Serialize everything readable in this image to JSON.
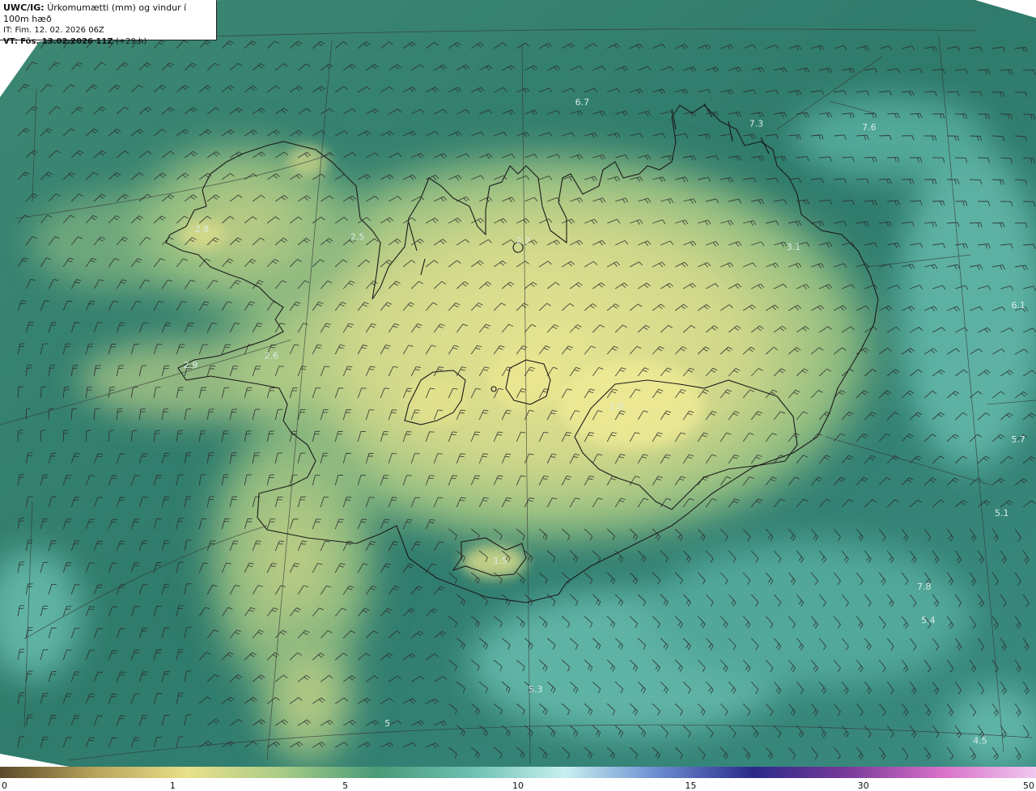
{
  "title": {
    "model": "UWC/IG:",
    "description": "Úrkomumætti (mm) og vindur í 100m hæð",
    "init_time": "IT: Fim. 12. 02. 2026 06Z",
    "valid_prefix": "VT:",
    "valid_time": "Fös. 13.02.2026 11Z",
    "lead": "(+29 h)"
  },
  "field_labels": [
    {
      "text": "6.7",
      "fx": 0.562,
      "fy": 0.137
    },
    {
      "text": "7.3",
      "fx": 0.73,
      "fy": 0.165
    },
    {
      "text": "7.6",
      "fx": 0.839,
      "fy": 0.17
    },
    {
      "text": "2.8",
      "fx": 0.195,
      "fy": 0.303
    },
    {
      "text": "2.5",
      "fx": 0.345,
      "fy": 0.313
    },
    {
      "text": "2.2",
      "fx": 0.505,
      "fy": 0.318
    },
    {
      "text": "3.1",
      "fx": 0.766,
      "fy": 0.326
    },
    {
      "text": "6.1",
      "fx": 0.983,
      "fy": 0.402
    },
    {
      "text": "2.6",
      "fx": 0.262,
      "fy": 0.468
    },
    {
      "text": "2.9",
      "fx": 0.184,
      "fy": 0.48
    },
    {
      "text": "1.0",
      "fx": 0.595,
      "fy": 0.534
    },
    {
      "text": "5.7",
      "fx": 0.983,
      "fy": 0.577
    },
    {
      "text": "5.1",
      "fx": 0.967,
      "fy": 0.673
    },
    {
      "text": "1.5",
      "fx": 0.483,
      "fy": 0.735
    },
    {
      "text": "7.8",
      "fx": 0.892,
      "fy": 0.769
    },
    {
      "text": "5.4",
      "fx": 0.896,
      "fy": 0.813
    },
    {
      "text": "5.3",
      "fx": 0.517,
      "fy": 0.903
    },
    {
      "text": "5",
      "fx": 0.374,
      "fy": 0.947
    },
    {
      "text": "4.5",
      "fx": 0.946,
      "fy": 0.97
    }
  ],
  "colorbar": {
    "ticks": [
      {
        "label": "0",
        "frac": 0.0
      },
      {
        "label": "1",
        "frac": 0.1667
      },
      {
        "label": "5",
        "frac": 0.3333
      },
      {
        "label": "10",
        "frac": 0.5
      },
      {
        "label": "15",
        "frac": 0.6667
      },
      {
        "label": "30",
        "frac": 0.8333
      },
      {
        "label": "50",
        "frac": 1.0
      }
    ],
    "colors": [
      "#5a4a2a",
      "#b8a35a",
      "#e8e08a",
      "#a8cc88",
      "#4a9a78",
      "#6cc0b0",
      "#c8f0f0",
      "#6a8ad0",
      "#2a2a88",
      "#7a3a9a",
      "#d870c8",
      "#f0c8f0"
    ]
  },
  "colors": {
    "land_high": "#e5e38e",
    "ocean_deep": "#2f7a6e",
    "coastline": "#1a1a1a",
    "graticule": "#333333"
  }
}
